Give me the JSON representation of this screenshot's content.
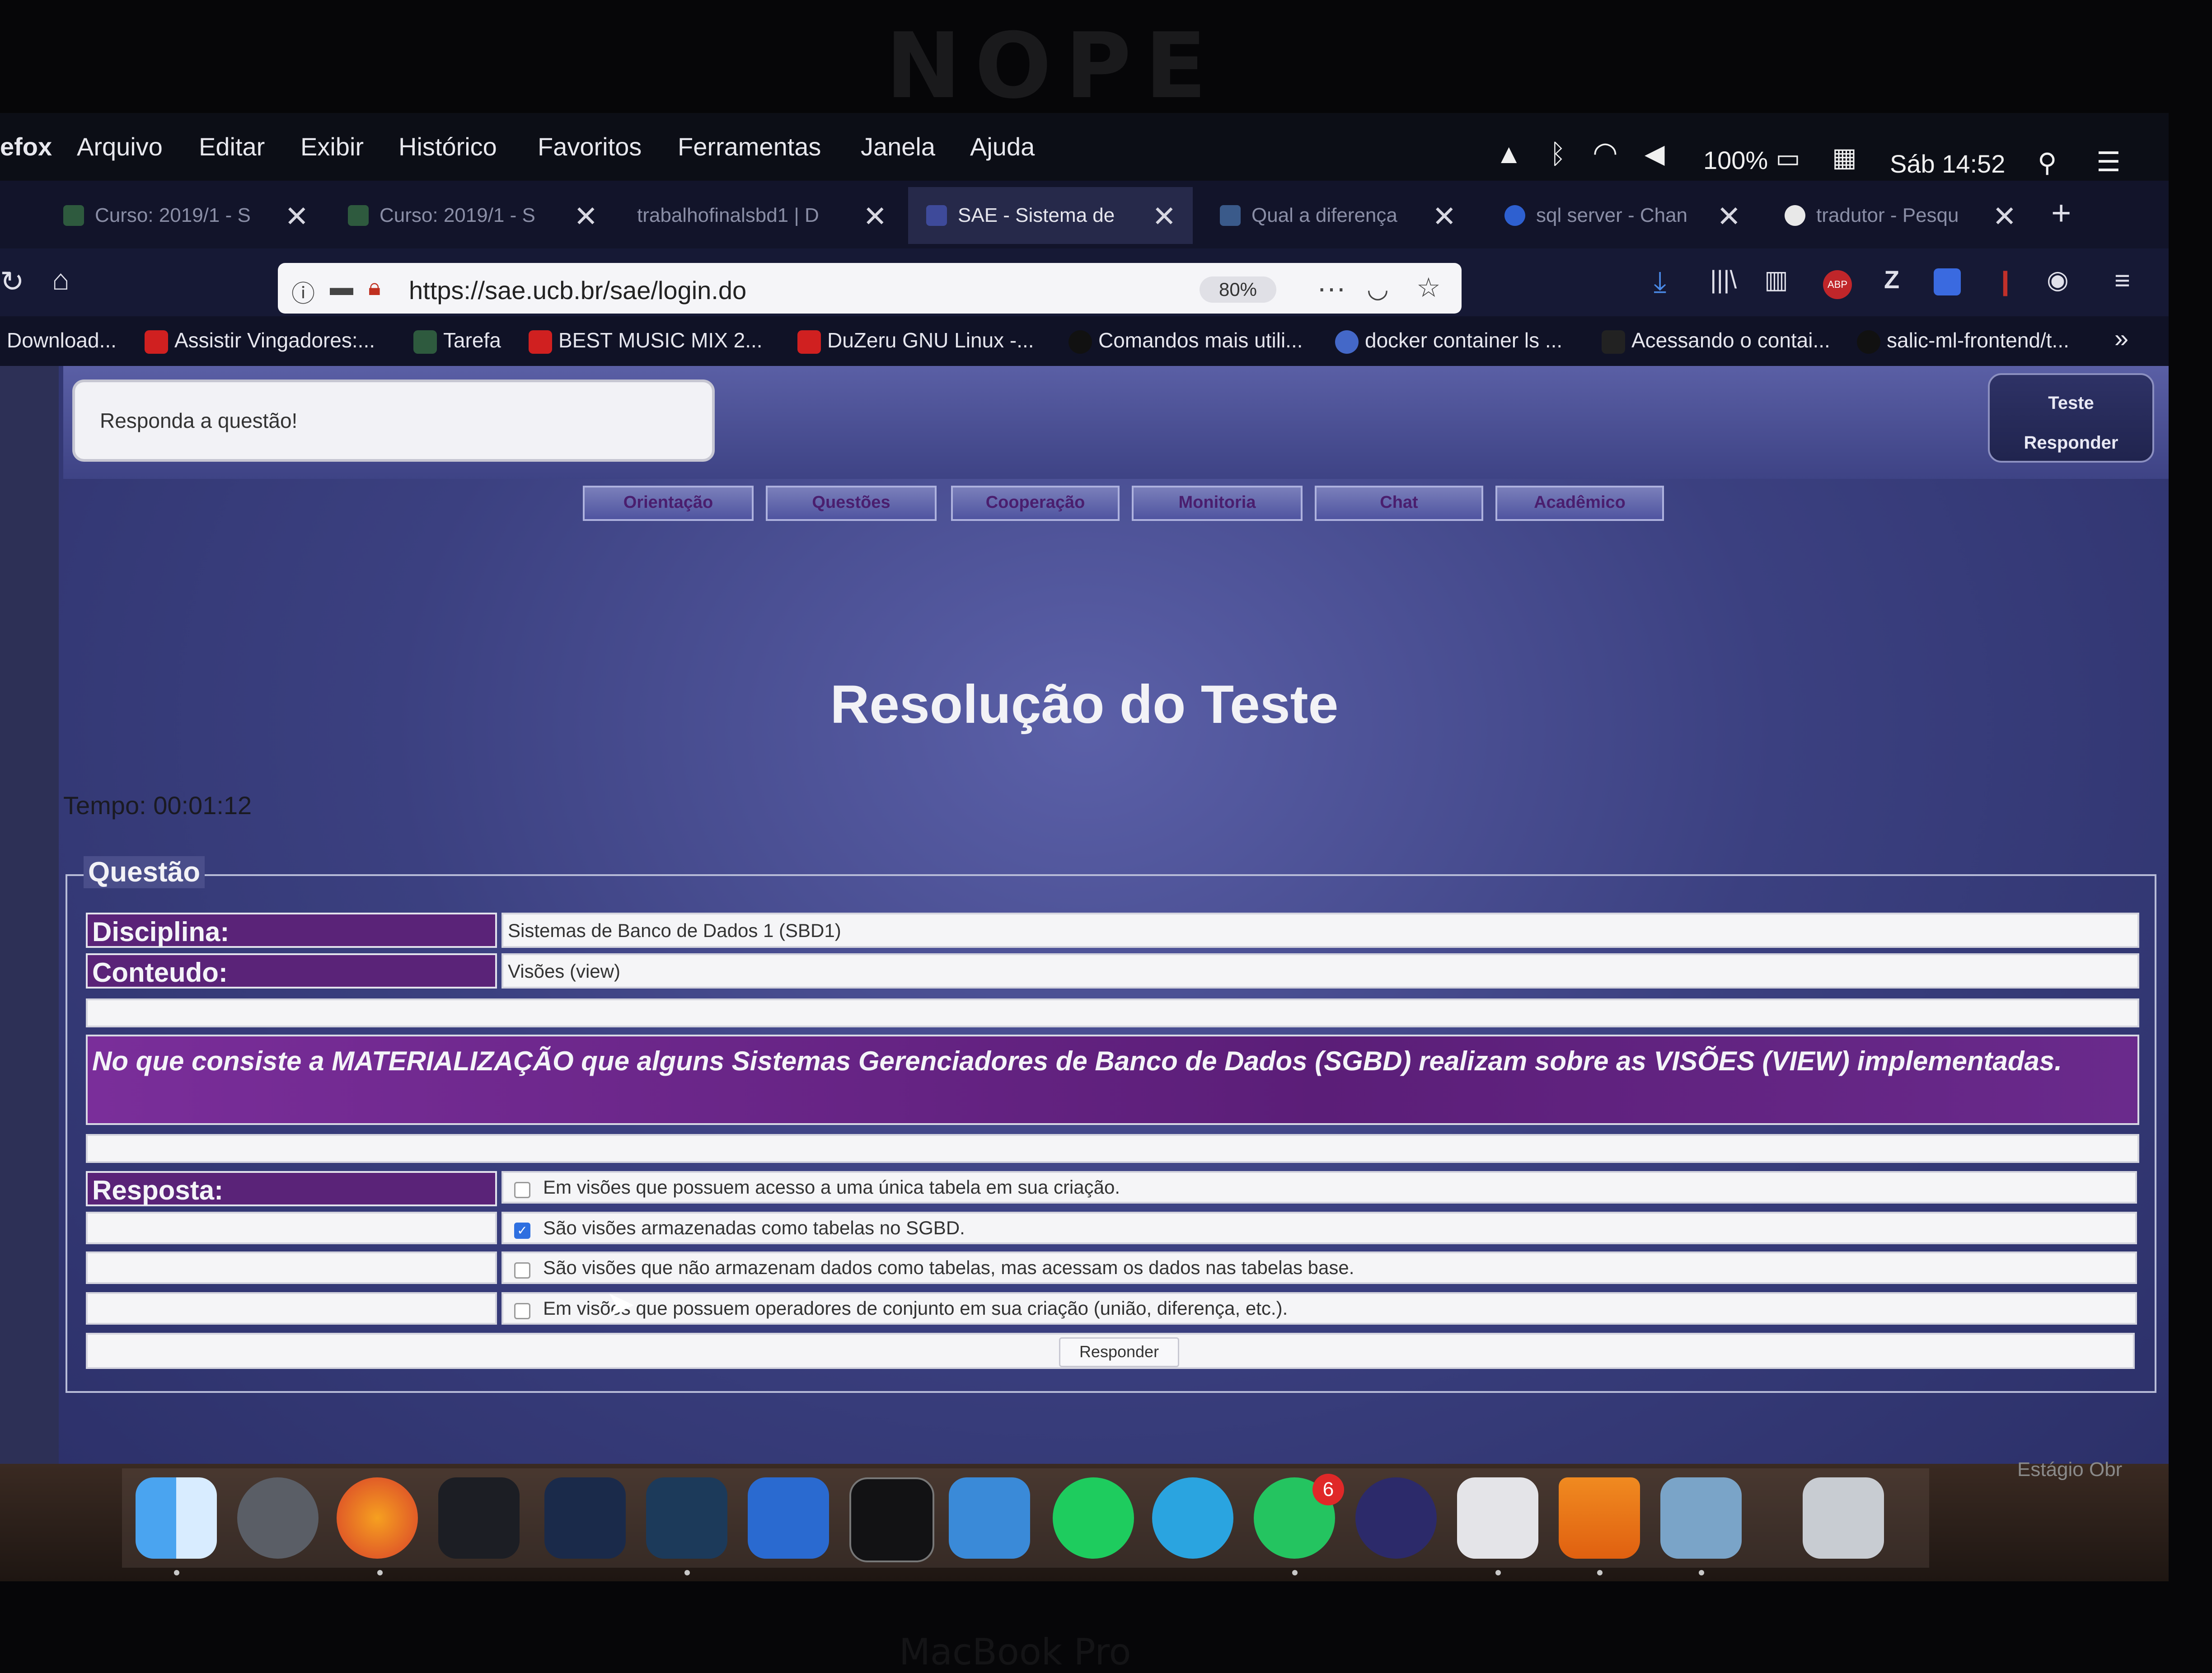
{
  "bezel": {
    "logo": "NOPE",
    "model": "MacBook Pro"
  },
  "menubar": {
    "app": "efox",
    "items": [
      "Arquivo",
      "Editar",
      "Exibir",
      "Histórico",
      "Favoritos",
      "Ferramentas",
      "Janela",
      "Ajuda"
    ],
    "battery": "100%",
    "clock": "Sáb 14:52"
  },
  "tabs": [
    {
      "label": "Curso: 2019/1 - S",
      "active": false
    },
    {
      "label": "Curso: 2019/1 - S",
      "active": false
    },
    {
      "label": "trabalhofinalsbd1 | D",
      "active": false
    },
    {
      "label": "SAE - Sistema de",
      "active": true
    },
    {
      "label": "Qual a diferença",
      "active": false
    },
    {
      "label": "sql server - Chan",
      "active": false
    },
    {
      "label": "tradutor - Pesqu",
      "active": false
    }
  ],
  "nav": {
    "url": "https://sae.ucb.br/sae/login.do",
    "zoom": "80%"
  },
  "bookmarks": [
    "Download...",
    "Assistir Vingadores:...",
    "Tarefa",
    "BEST MUSIC MIX 2...",
    "DuZeru GNU Linux -...",
    "Comandos mais utili...",
    "docker container ls ...",
    "Acessando o contai...",
    "salic-ml-frontend/t..."
  ],
  "page": {
    "message": "Responda a questão!",
    "side_buttons": [
      "Teste",
      "Responder"
    ],
    "nav_tabs": [
      "Orientação",
      "Questões",
      "Cooperação",
      "Monitoria",
      "Chat",
      "Acadêmico"
    ],
    "title": "Resolução do Teste",
    "timer": "Tempo: 00:01:12",
    "legend": "Questão",
    "disciplina_label": "Disciplina:",
    "disciplina_value": "Sistemas de Banco de Dados 1 (SBD1)",
    "conteudo_label": "Conteudo:",
    "conteudo_value": "Visões (view)",
    "question": "No que consiste a MATERIALIZAÇÃO que alguns Sistemas Gerenciadores de Banco de Dados (SGBD) realizam sobre as VISÕES (VIEW) implementadas.",
    "resposta_label": "Resposta:",
    "options": [
      {
        "text": "Em visões que possuem acesso a uma única tabela em sua criação.",
        "checked": false
      },
      {
        "text": "São visões armazenadas como tabelas no SGBD.",
        "checked": true
      },
      {
        "text": "São visões que não armazenam dados como tabelas, mas acessam os dados nas tabelas base.",
        "checked": false
      },
      {
        "text": "Em visões que possuem operadores de conjunto em sua criação (união, diferença, etc.).",
        "checked": false
      }
    ],
    "submit": "Responder"
  },
  "dock": {
    "badge": "6",
    "note": "Estágio Obr"
  }
}
